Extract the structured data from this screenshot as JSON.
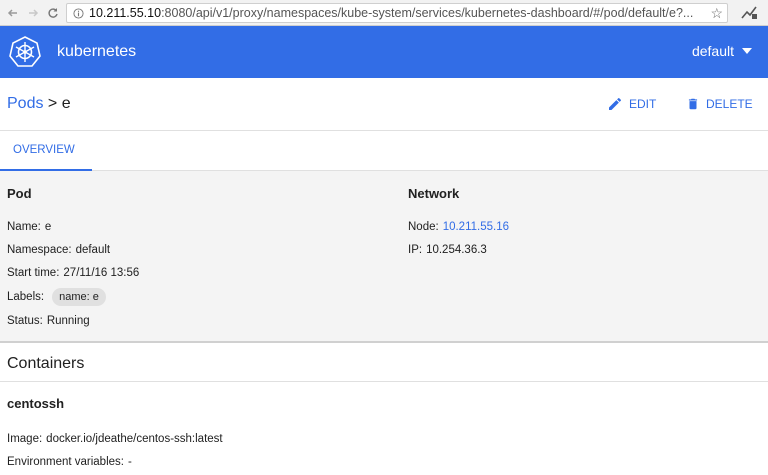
{
  "browser": {
    "url_host": "10.211.55.10",
    "url_rest": ":8080/api/v1/proxy/namespaces/kube-system/services/kubernetes-dashboard/#/pod/default/e?..."
  },
  "header": {
    "brand": "kubernetes",
    "namespace": "default",
    "color": "#326de6"
  },
  "breadcrumb": {
    "parent": "Pods",
    "sep": " > ",
    "current": "e"
  },
  "actions": {
    "edit": "EDIT",
    "delete": "DELETE"
  },
  "tabs": [
    {
      "label": "OVERVIEW"
    }
  ],
  "pod": {
    "title": "Pod",
    "name_label": "Name:",
    "name": "e",
    "namespace_label": "Namespace:",
    "namespace": "default",
    "start_label": "Start time:",
    "start": "27/11/16 13:56",
    "labels_label": "Labels:",
    "label_chip": "name: e",
    "status_label": "Status:",
    "status": "Running"
  },
  "network": {
    "title": "Network",
    "node_label": "Node:",
    "node": "10.211.55.16",
    "ip_label": "IP:",
    "ip": "10.254.36.3"
  },
  "containers": {
    "title": "Containers",
    "items": [
      {
        "name": "centossh",
        "image_label": "Image:",
        "image": "docker.io/jdeathe/centos-ssh:latest",
        "env_label": "Environment variables:",
        "env": "-"
      }
    ]
  }
}
